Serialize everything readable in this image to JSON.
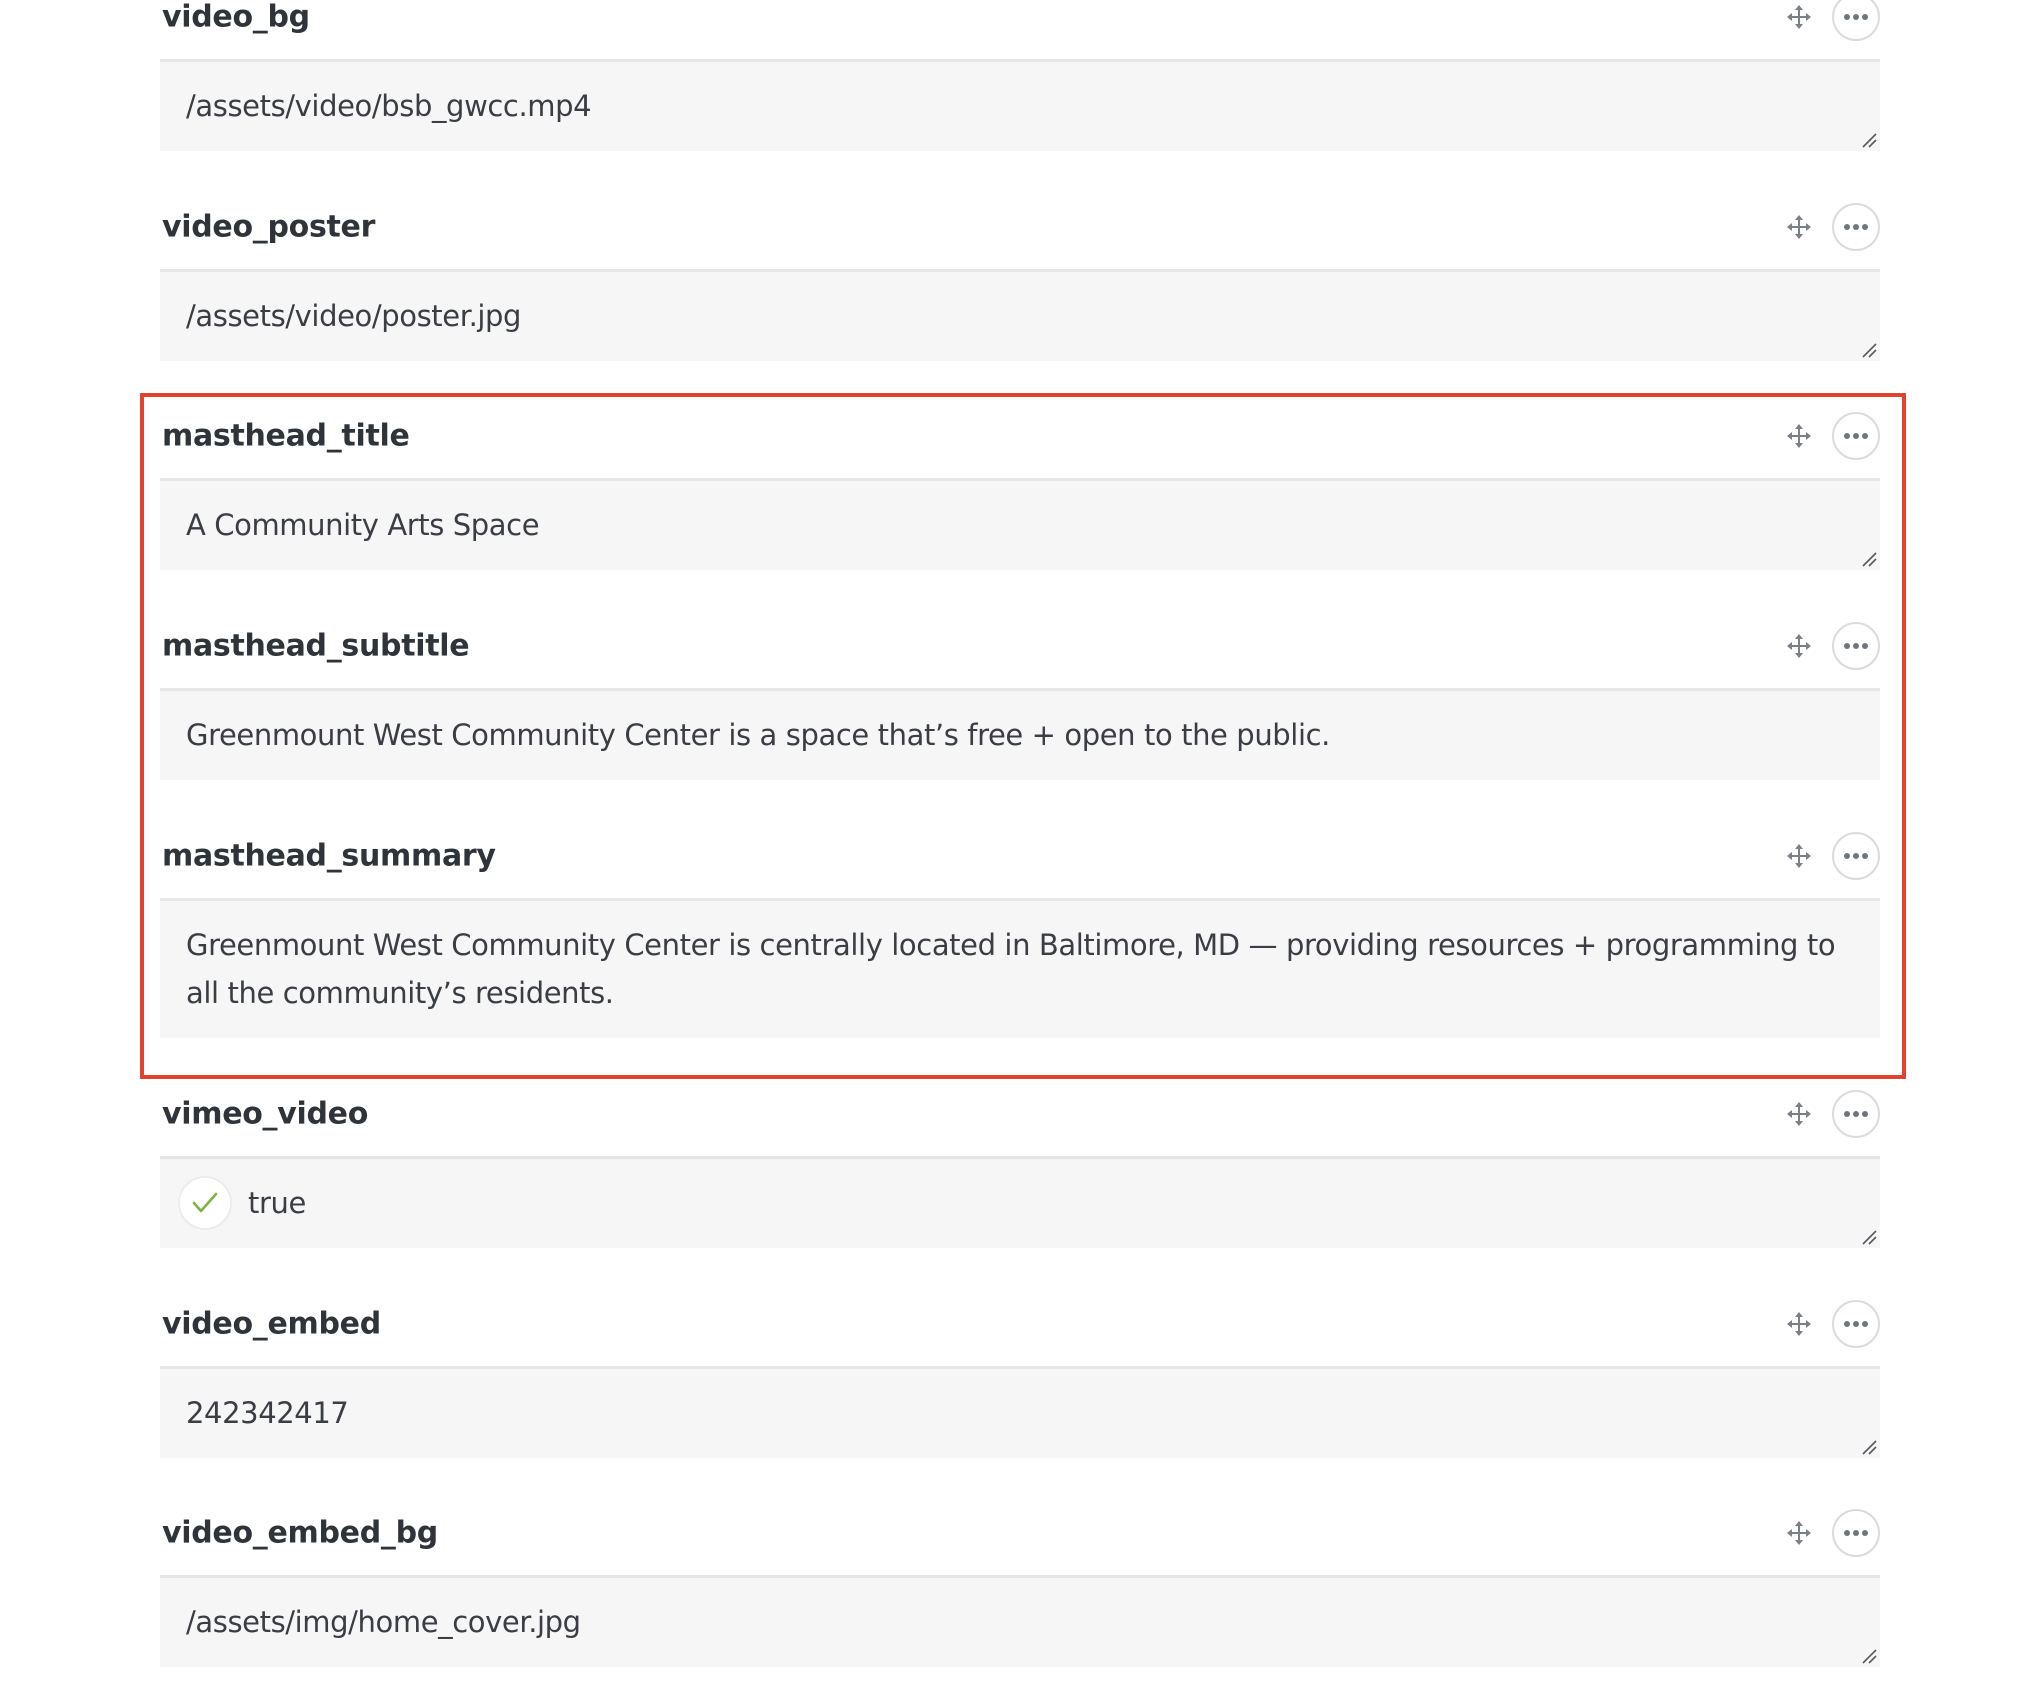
{
  "fields": [
    {
      "key": "video_bg",
      "value": "/assets/video/bsb_gwcc.mp4"
    },
    {
      "key": "video_poster",
      "value": "/assets/video/poster.jpg"
    },
    {
      "key": "masthead_title",
      "value": "A Community Arts Space"
    },
    {
      "key": "masthead_subtitle",
      "value": "Greenmount West Community Center is a space that’s free + open to the public."
    },
    {
      "key": "masthead_summary",
      "value": "Greenmount West Community Center is centrally located in Baltimore, MD — providing resources + programming to all the community’s residents."
    },
    {
      "key": "vimeo_video",
      "value": "true"
    },
    {
      "key": "video_embed",
      "value": "242342417"
    },
    {
      "key": "video_embed_bg",
      "value": "/assets/img/home_cover.jpg"
    }
  ],
  "icons": {
    "move": "move-icon",
    "more": "more-icon",
    "check": "checkmark-icon",
    "resize": "resize-handle-icon"
  },
  "colors": {
    "highlight": "#e2432f",
    "check": "#7cb342",
    "field_background": "#f6f6f6"
  }
}
